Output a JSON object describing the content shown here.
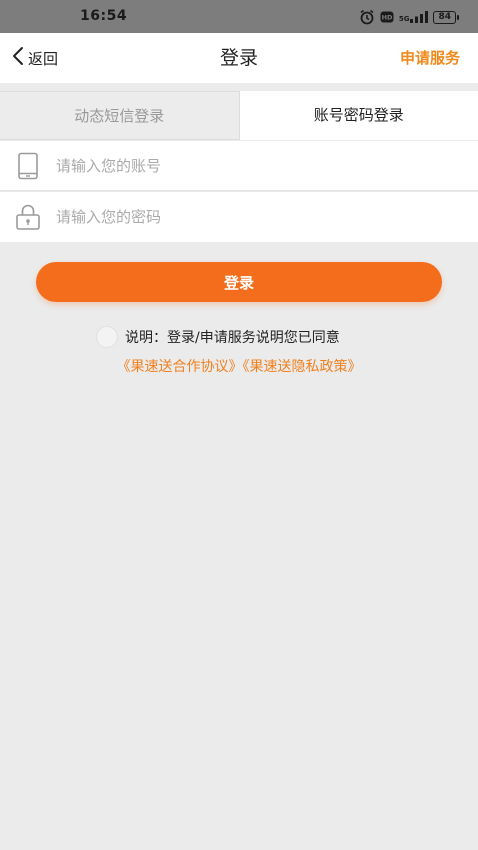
{
  "status_bar": {
    "time": "16:54",
    "signal_label": "5G",
    "battery": "84"
  },
  "nav": {
    "back_label": "返回",
    "title": "登录",
    "apply_label": "申请服务"
  },
  "tabs": [
    {
      "label": "动态短信登录",
      "active": false
    },
    {
      "label": "账号密码登录",
      "active": true
    }
  ],
  "form": {
    "account_placeholder": "请输入您的账号",
    "account_value": "",
    "password_placeholder": "请输入您的密码",
    "password_value": "",
    "login_label": "登录"
  },
  "agreement": {
    "checked": false,
    "text": "说明：登录/申请服务说明您已同意",
    "links": [
      "《果速送合作协议》",
      "《果速送隐私政策》"
    ]
  },
  "colors": {
    "accent": "#f46d1c",
    "link": "#f0811f",
    "background": "#ebebeb"
  },
  "icons": {
    "account": "phone-icon",
    "password": "lock-icon",
    "back": "chevron-left-icon"
  }
}
